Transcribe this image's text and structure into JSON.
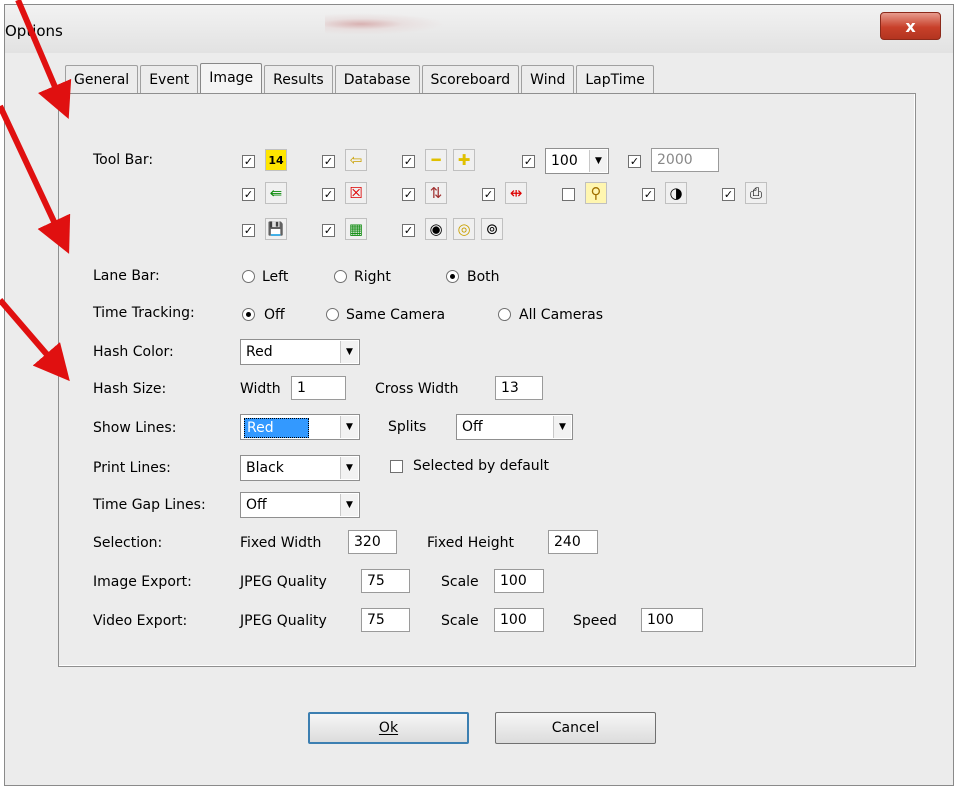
{
  "window": {
    "title": "Options",
    "close_label": "x"
  },
  "tabs": [
    "General",
    "Event",
    "Image",
    "Results",
    "Database",
    "Scoreboard",
    "Wind",
    "LapTime"
  ],
  "toolbar": {
    "label": "Tool Bar:",
    "zoom_value": "100",
    "number_value": "2000",
    "row1_icons": [
      "calendar-14-icon",
      "arrow-left-icon",
      "minus-icon",
      "plus-icon"
    ],
    "row2_icons": [
      "green-export-icon",
      "red-cross-icon",
      "transfer-icon",
      "split-lines-icon",
      "magnifier-icon",
      "contrast-icon",
      "printer-icon"
    ],
    "row3_icons": [
      "save-icon",
      "green-grid-icon",
      "target-icon",
      "yellow-ring-icon",
      "camera-lens-icon"
    ],
    "icon_glyphs": {
      "calendar14": "14",
      "arrowleft": "⇦",
      "minus": "━",
      "plus": "✚",
      "export": "⇚",
      "redx": "☒",
      "transfer": "⇅",
      "split": "⇹",
      "magnifier": "⚲",
      "contrast": "◑",
      "printer": "⎙",
      "save": "💾",
      "grid": "▦",
      "target": "◉",
      "ring": "◎",
      "lens": "⊚"
    }
  },
  "lane_bar": {
    "label": "Lane Bar:",
    "options": [
      "Left",
      "Right",
      "Both"
    ],
    "selected": "Both"
  },
  "time_tracking": {
    "label": "Time Tracking:",
    "options": [
      "Off",
      "Same Camera",
      "All Cameras"
    ],
    "selected": "Off"
  },
  "hash_color": {
    "label": "Hash Color:",
    "value": "Red"
  },
  "hash_size": {
    "label": "Hash Size:",
    "width_label": "Width",
    "width_value": "1",
    "cross_label": "Cross Width",
    "cross_value": "13"
  },
  "show_lines": {
    "label": "Show Lines:",
    "value": "Red",
    "splits_label": "Splits",
    "splits_value": "Off"
  },
  "print_lines": {
    "label": "Print Lines:",
    "value": "Black",
    "default_label": "Selected by default"
  },
  "time_gap_lines": {
    "label": "Time Gap Lines:",
    "value": "Off"
  },
  "selection": {
    "label": "Selection:",
    "fw_label": "Fixed Width",
    "fw_value": "320",
    "fh_label": "Fixed Height",
    "fh_value": "240"
  },
  "image_export": {
    "label": "Image Export:",
    "q_label": "JPEG Quality",
    "q_value": "75",
    "s_label": "Scale",
    "s_value": "100"
  },
  "video_export": {
    "label": "Video Export:",
    "q_label": "JPEG Quality",
    "q_value": "75",
    "s_label": "Scale",
    "s_value": "100",
    "sp_label": "Speed",
    "sp_value": "100"
  },
  "buttons": {
    "ok": "Ok",
    "cancel": "Cancel"
  },
  "colors": {
    "arrow": "#e01010",
    "selection": "#3399ff",
    "close": "#c8402a"
  }
}
